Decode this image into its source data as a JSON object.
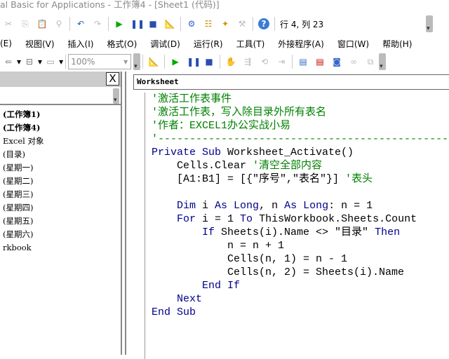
{
  "title": "al Basic for Applications - 工作簿4 - [Sheet1 (代码)]",
  "status": "行 4, 列 23",
  "menu": [
    "(E)",
    "视图(V)",
    "插入(I)",
    "格式(O)",
    "调试(D)",
    "运行(R)",
    "工具(T)",
    "外接程序(A)",
    "窗口(W)",
    "帮助(H)"
  ],
  "zoom": "100%",
  "close_label": "X",
  "tree": [
    {
      "label": "(工作簿1)",
      "bold": true
    },
    {
      "label": "(工作簿4)",
      "bold": true
    },
    {
      "label": "Excel 对象",
      "bold": false
    },
    {
      "label": " (目录)",
      "bold": false
    },
    {
      "label": " (星期一)",
      "bold": false
    },
    {
      "label": " (星期二)",
      "bold": false
    },
    {
      "label": " (星期三)",
      "bold": false
    },
    {
      "label": " (星期四)",
      "bold": false
    },
    {
      "label": " (星期五)",
      "bold": false
    },
    {
      "label": " (星期六)",
      "bold": false
    },
    {
      "label": "rkbook",
      "bold": false
    }
  ],
  "object_combo": "Worksheet",
  "colors": {
    "comment": "#008000",
    "keyword": "#00008b"
  },
  "code": [
    [
      [
        "cm",
        "'激活工作表事件"
      ]
    ],
    [
      [
        "cm",
        "'激活工作表，写入除目录外所有表名"
      ]
    ],
    [
      [
        "cm",
        "'作者：EXCEL1办公实战小易"
      ]
    ],
    [
      [
        "cm",
        "'------------------------------------------------"
      ]
    ],
    [
      [
        "kw",
        "Private Sub"
      ],
      [
        "tx",
        " Worksheet_Activate()"
      ]
    ],
    [
      [
        "tx",
        "    Cells.Clear "
      ],
      [
        "cm",
        "'清空全部内容"
      ]
    ],
    [
      [
        "tx",
        "    [A1:B1] = [{\"序号\",\"表名\"}] "
      ],
      [
        "cm",
        "'表头"
      ]
    ],
    [
      [
        "tx",
        ""
      ]
    ],
    [
      [
        "tx",
        "    "
      ],
      [
        "kw",
        "Dim"
      ],
      [
        "tx",
        " i "
      ],
      [
        "kw",
        "As Long"
      ],
      [
        "tx",
        ", n "
      ],
      [
        "kw",
        "As Long"
      ],
      [
        "tx",
        ": n = 1"
      ]
    ],
    [
      [
        "tx",
        "    "
      ],
      [
        "kw",
        "For"
      ],
      [
        "tx",
        " i = 1 "
      ],
      [
        "kw",
        "To"
      ],
      [
        "tx",
        " ThisWorkbook.Sheets.Count"
      ]
    ],
    [
      [
        "tx",
        "        "
      ],
      [
        "kw",
        "If"
      ],
      [
        "tx",
        " Sheets(i).Name <> \"目录\" "
      ],
      [
        "kw",
        "Then"
      ]
    ],
    [
      [
        "tx",
        "            n = n + 1"
      ]
    ],
    [
      [
        "tx",
        "            Cells(n, 1) = n - 1"
      ]
    ],
    [
      [
        "tx",
        "            Cells(n, 2) = Sheets(i).Name"
      ]
    ],
    [
      [
        "tx",
        "        "
      ],
      [
        "kw",
        "End If"
      ]
    ],
    [
      [
        "tx",
        "    "
      ],
      [
        "kw",
        "Next"
      ]
    ],
    [
      [
        "kw",
        "End Sub"
      ]
    ]
  ]
}
